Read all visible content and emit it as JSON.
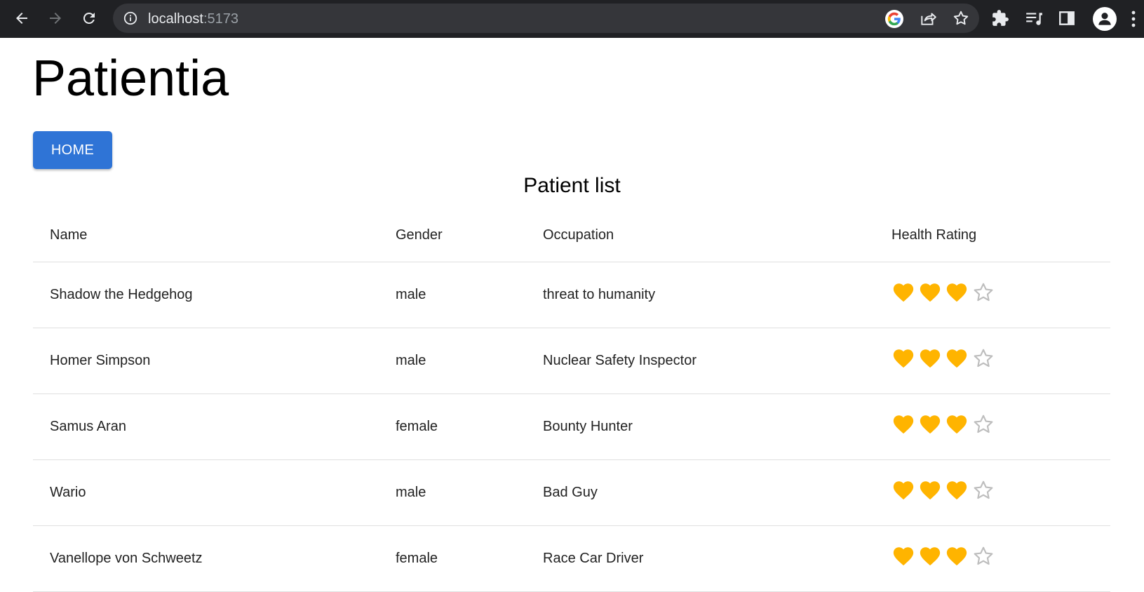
{
  "browser": {
    "url_host": "localhost",
    "url_port": ":5173",
    "icons": [
      "back-icon",
      "forward-icon",
      "reload-icon",
      "site-info-icon",
      "google-lens-icon",
      "share-icon",
      "bookmark-star-icon",
      "extensions-icon",
      "reading-list-icon",
      "side-panel-icon",
      "profile-icon",
      "menu-icon"
    ]
  },
  "app": {
    "title": "Patientia",
    "home_label": "HOME",
    "list_title": "Patient list"
  },
  "table": {
    "headers": {
      "name": "Name",
      "gender": "Gender",
      "occupation": "Occupation",
      "rating": "Health Rating"
    },
    "rows": [
      {
        "name": "Shadow the Hedgehog",
        "gender": "male",
        "occupation": "threat to humanity",
        "rating": 3,
        "max": 4
      },
      {
        "name": "Homer Simpson",
        "gender": "male",
        "occupation": "Nuclear Safety Inspector",
        "rating": 3,
        "max": 4
      },
      {
        "name": "Samus Aran",
        "gender": "female",
        "occupation": "Bounty Hunter",
        "rating": 3,
        "max": 4
      },
      {
        "name": "Wario",
        "gender": "male",
        "occupation": "Bad Guy",
        "rating": 3,
        "max": 4
      },
      {
        "name": "Vanellope von Schweetz",
        "gender": "female",
        "occupation": "Race Car Driver",
        "rating": 3,
        "max": 4
      }
    ]
  },
  "colors": {
    "heart": "#ffb400",
    "empty_star": "#bdbdbd",
    "button": "#2f74d6",
    "chrome_bg": "#202124"
  }
}
